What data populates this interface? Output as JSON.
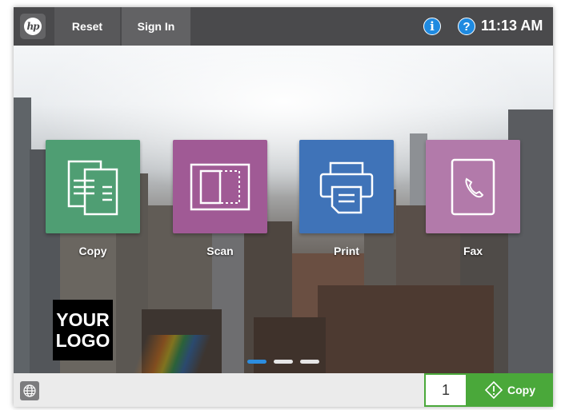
{
  "topbar": {
    "reset_label": "Reset",
    "signin_label": "Sign In",
    "info_glyph": "i",
    "help_glyph": "?",
    "time": "11:13 AM",
    "brand_logo_text": "hp"
  },
  "apps": [
    {
      "label": "Copy",
      "color": "#4f9e73",
      "icon": "copy-icon"
    },
    {
      "label": "Scan",
      "color": "#a05a95",
      "icon": "scan-icon"
    },
    {
      "label": "Print",
      "color": "#3f73b8",
      "icon": "print-icon"
    },
    {
      "label": "Fax",
      "color": "#b27aaa",
      "icon": "fax-icon"
    }
  ],
  "logo": {
    "line1": "YOUR",
    "line2": "LOGO"
  },
  "pager": {
    "pages": 3,
    "active": 1
  },
  "bottombar": {
    "quantity": "1",
    "copy_label": "Copy",
    "language_icon": "globe-icon"
  },
  "colors": {
    "accent_green": "#4aa83a",
    "info_blue": "#1f8ae0",
    "topbar": "#4a4a4c"
  }
}
